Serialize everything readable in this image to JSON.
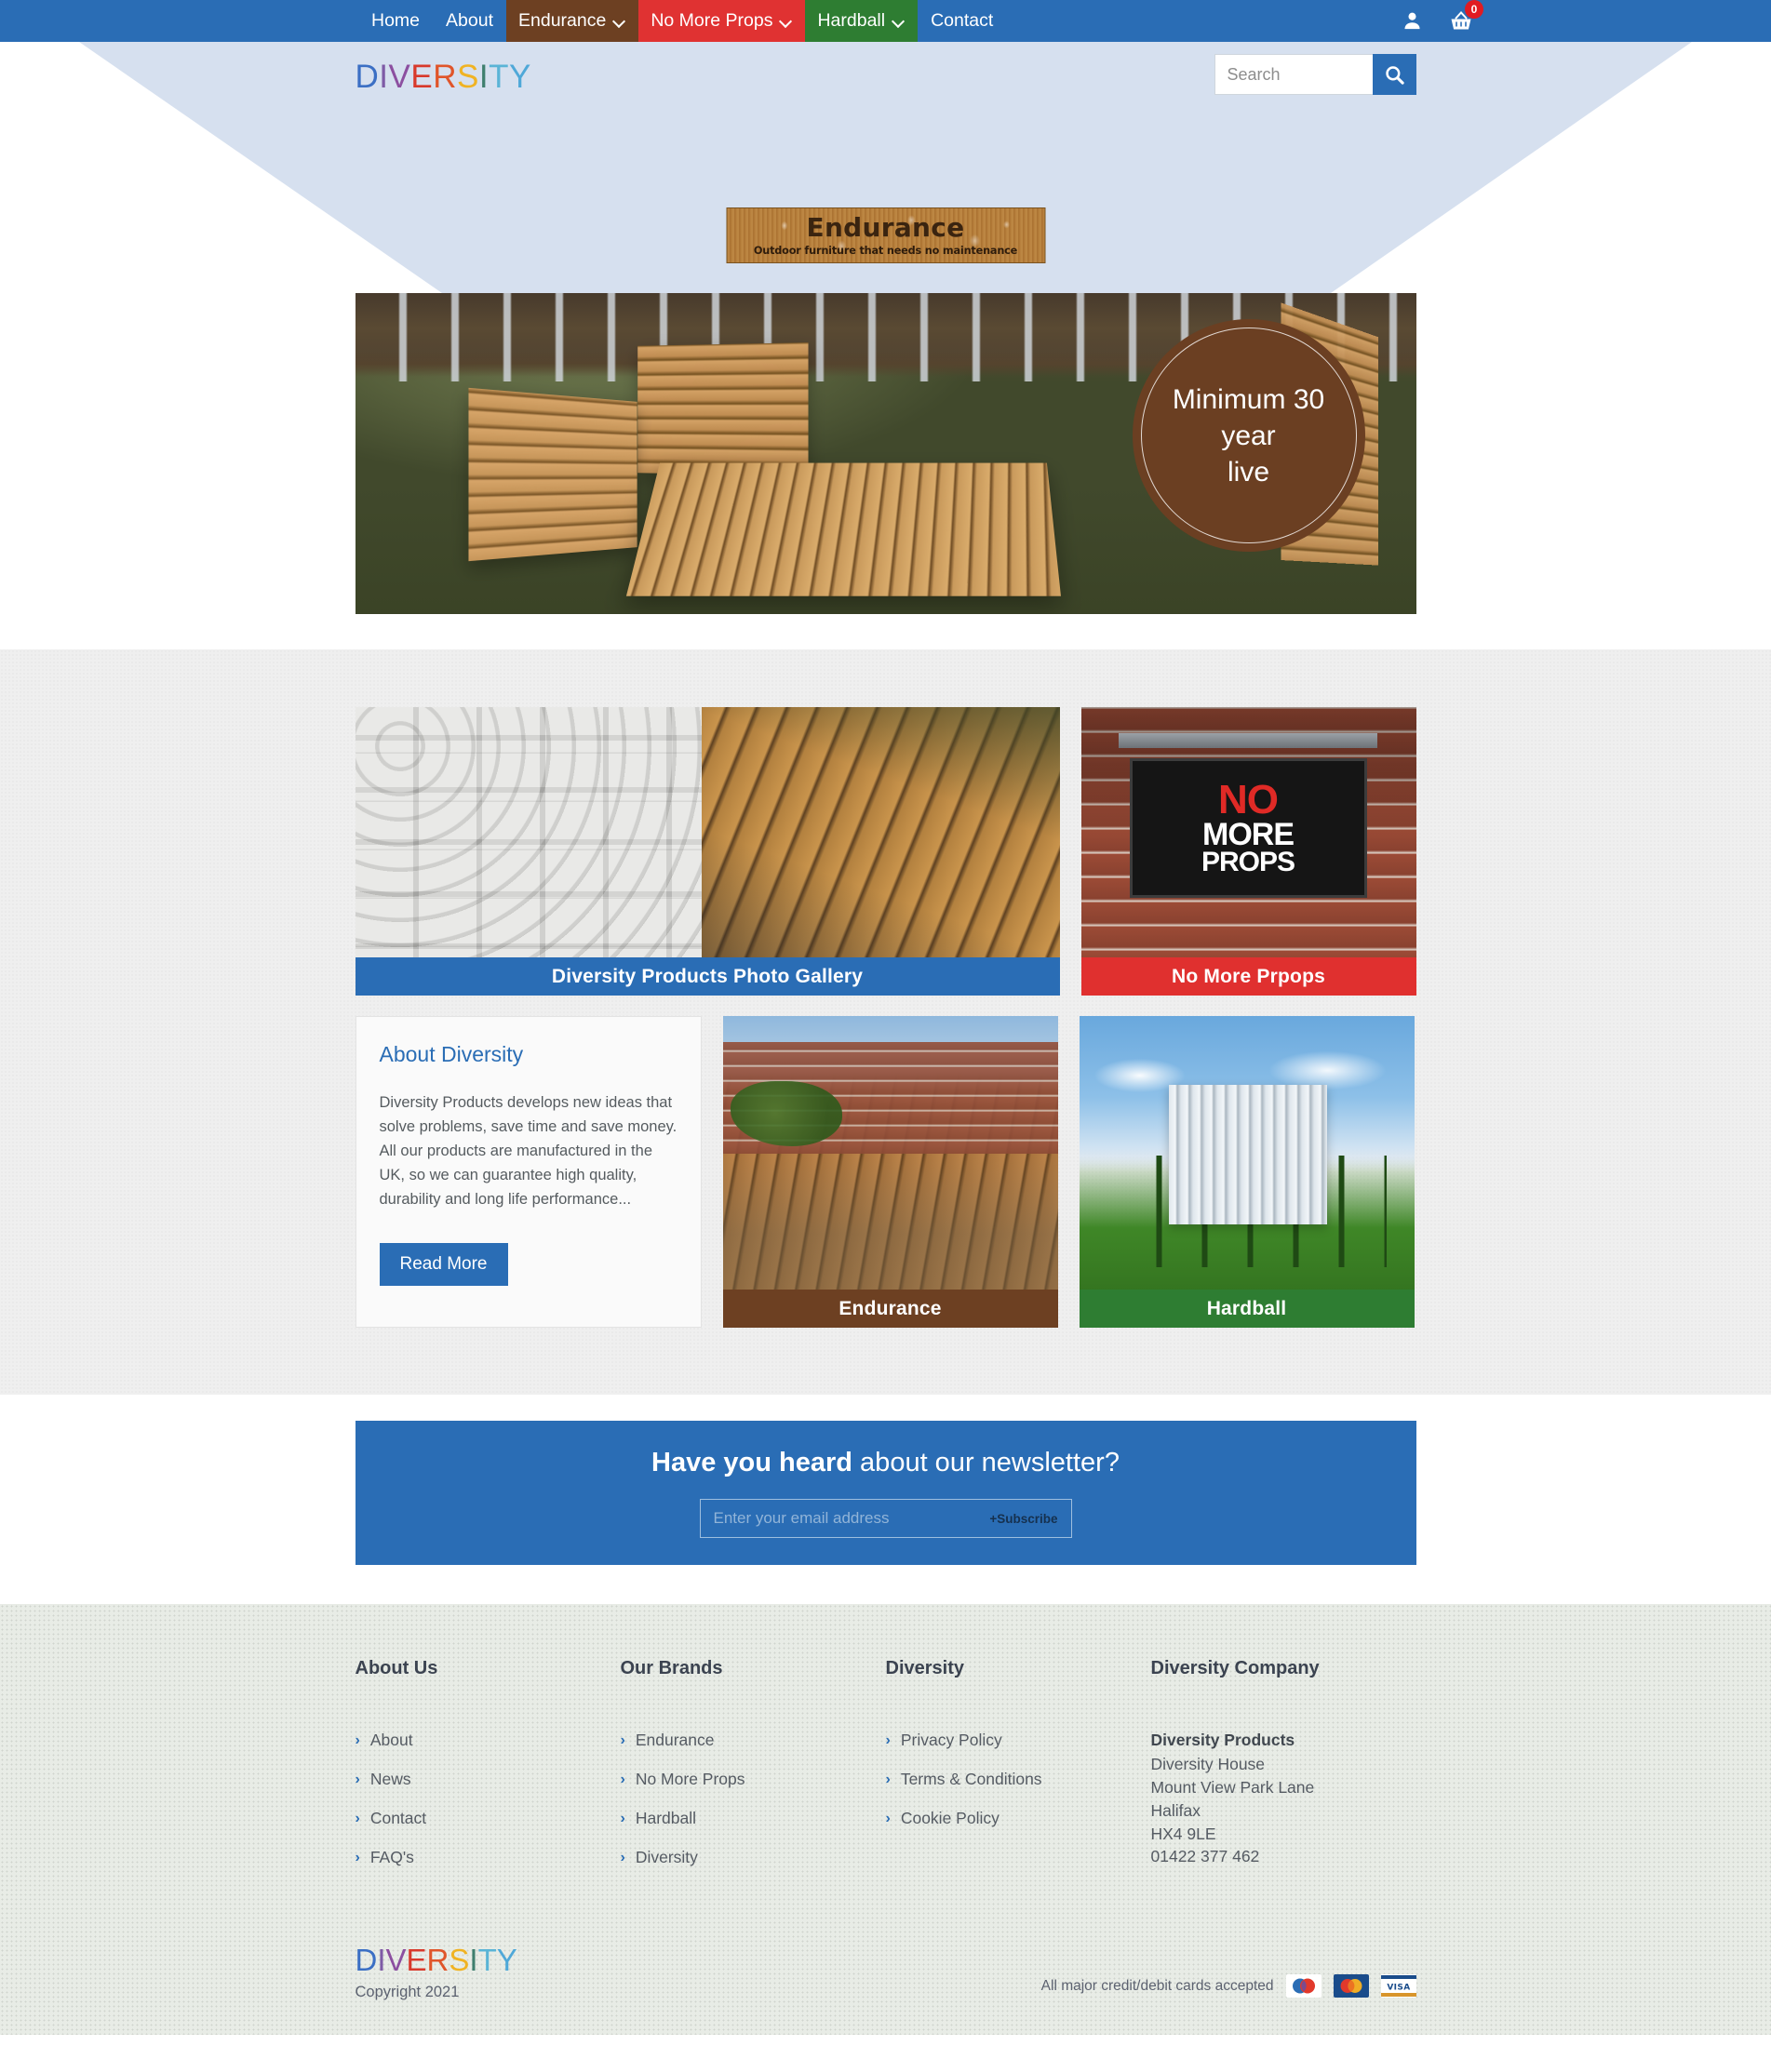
{
  "nav": {
    "items": [
      {
        "label": "Home",
        "style": "plain",
        "caret": false
      },
      {
        "label": "About",
        "style": "plain",
        "caret": false
      },
      {
        "label": "Endurance",
        "style": "brown",
        "caret": true
      },
      {
        "label": "No More Props",
        "style": "red",
        "caret": true
      },
      {
        "label": "Hardball",
        "style": "green",
        "caret": true
      },
      {
        "label": "Contact",
        "style": "plain",
        "caret": false
      }
    ],
    "account_icon": "user-icon",
    "cart_icon": "shopping-basket-icon",
    "cart_count": "0"
  },
  "header": {
    "logo_letters": [
      {
        "ch": "D",
        "color": "#3b6fc4"
      },
      {
        "ch": "I",
        "color": "#7e5ba6"
      },
      {
        "ch": "V",
        "color": "#8c4fa0"
      },
      {
        "ch": "E",
        "color": "#d8392b"
      },
      {
        "ch": "R",
        "color": "#e0552a"
      },
      {
        "ch": "S",
        "color": "#f0b323"
      },
      {
        "ch": "I",
        "color": "#3f7f6e"
      },
      {
        "ch": "T",
        "color": "#5ab4d6"
      },
      {
        "ch": "Y",
        "color": "#4fa8d8"
      }
    ],
    "search_placeholder": "Search",
    "search_value": "",
    "search_icon": "search-icon",
    "brand_banner": {
      "title": "Endurance",
      "tagline": "Outdoor furniture that needs no maintenance"
    }
  },
  "hero": {
    "badge_line1": "Minimum 30 year",
    "badge_line2": "live",
    "badge_color": "#6b3f22"
  },
  "cards": {
    "gallery": {
      "caption": "Diversity Products Photo Gallery",
      "caption_color": "#2a6db5"
    },
    "no_more_props": {
      "caption": "No More Prpops",
      "caption_color": "#e0302f",
      "sign_line1": "NO",
      "sign_line2": "MORE",
      "sign_line3": "PROPS"
    },
    "about": {
      "title": "About Diversity",
      "body": "Diversity Products develops new ideas that solve problems, save time and save money. All our products are manufactured in the UK, so we can guarantee high quality, durability and long life performance...",
      "button": "Read More"
    },
    "endurance": {
      "caption": "Endurance",
      "caption_color": "#6d4022"
    },
    "hardball": {
      "caption": "Hardball",
      "caption_color": "#2e7d32"
    }
  },
  "newsletter": {
    "title_bold": "Have you heard",
    "title_rest": " about our newsletter?",
    "placeholder": "Enter your email address",
    "value": "",
    "subscribe": "+Subscribe"
  },
  "footer": {
    "columns": [
      {
        "title": "About Us",
        "links": [
          "About",
          "News",
          "Contact",
          "FAQ's"
        ]
      },
      {
        "title": "Our Brands",
        "links": [
          "Endurance",
          "No More Props",
          "Hardball",
          "Diversity"
        ]
      },
      {
        "title": "Diversity",
        "links": [
          "Privacy Policy",
          "Terms & Conditions",
          "Cookie Policy"
        ]
      }
    ],
    "company": {
      "title": "Diversity Company",
      "name": "Diversity Products",
      "lines": [
        "Diversity House",
        "Mount View Park Lane",
        "Halifax",
        "HX4 9LE",
        "01422 377 462"
      ]
    },
    "copyright": "Copyright 2021",
    "payments_text": "All major credit/debit cards accepted",
    "payment_cards": [
      "maestro-card-icon",
      "mastercard-card-icon",
      "visa-card-icon"
    ]
  }
}
